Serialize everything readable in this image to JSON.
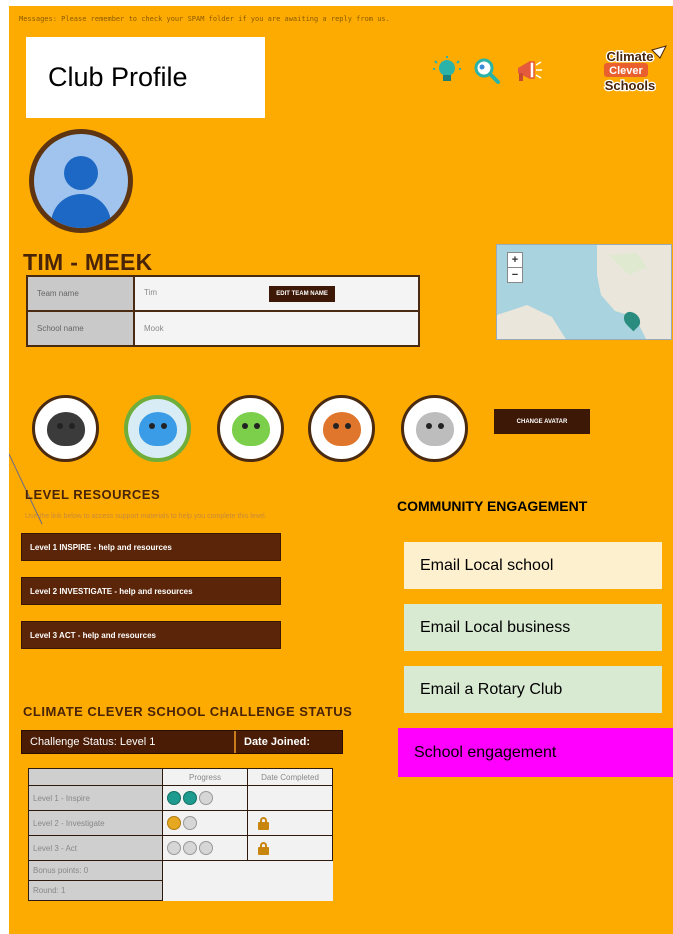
{
  "header": {
    "message": "Messages: Please remember to check your SPAM folder if you are awaiting a reply from us.",
    "title": "Club Profile",
    "icons": [
      "lightbulb-icon",
      "magnifier-icon",
      "megaphone-icon"
    ],
    "logo": {
      "line1": "Climate",
      "line2": "Clever",
      "line3": "Schools"
    }
  },
  "profile": {
    "team_title": "TIM - MEEK",
    "team_name_label": "Team name",
    "team_name_value": "Tim",
    "edit_team_name": "EDIT TEAM NAME",
    "school_name_label": "School name",
    "school_name_value": "Mook",
    "map_zoom_in": "+",
    "map_zoom_out": "−"
  },
  "avatars": {
    "options": [
      "smoke-creature",
      "water-creature",
      "leaf-creature",
      "fire-creature",
      "wind-creature"
    ],
    "selected_index": 1,
    "change_button": "CHANGE AVATAR"
  },
  "level_resources": {
    "heading": "LEVEL RESOURCES",
    "subtext": "Use the link below to access support materials to help you complete this level.",
    "links": [
      "Level 1 INSPIRE - help and resources",
      "Level 2 INVESTIGATE - help and resources",
      "Level 3 ACT - help and resources"
    ]
  },
  "community": {
    "heading": "COMMUNITY ENGAGEMENT",
    "buttons": [
      {
        "label": "Email Local school",
        "color": "#fdf0cf"
      },
      {
        "label": "Email Local business",
        "color": "#d9ead3"
      },
      {
        "label": "Email a Rotary Club",
        "color": "#d9ead3"
      },
      {
        "label": "School engagement",
        "color": "#ff00ff"
      }
    ]
  },
  "challenge": {
    "heading": "CLIMATE CLEVER SCHOOL CHALLENGE STATUS",
    "status": "Challenge Status: Level 1",
    "date_joined": "Date Joined:",
    "columns": [
      "",
      "Progress",
      "Date Completed"
    ],
    "rows": [
      {
        "label": "Level 1 - Inspire",
        "badges": [
          "teal",
          "teal",
          "grey"
        ],
        "locked": false
      },
      {
        "label": "Level 2 - Investigate",
        "badges": [
          "gold",
          "grey"
        ],
        "locked": true
      },
      {
        "label": "Level 3 - Act",
        "badges": [
          "grey",
          "grey",
          "grey"
        ],
        "locked": true
      }
    ],
    "bonus_points": "Bonus points: 0",
    "round": "Round: 1"
  },
  "colors": {
    "page_background": "#fdab01",
    "dark_brown": "#4a1c05"
  }
}
